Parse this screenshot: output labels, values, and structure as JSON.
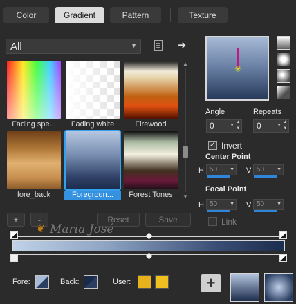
{
  "tabs": [
    {
      "label": "Color",
      "active": false
    },
    {
      "label": "Gradient",
      "active": true
    },
    {
      "label": "Pattern",
      "active": false
    },
    {
      "label": "Texture",
      "active": false
    }
  ],
  "category": {
    "selected": "All"
  },
  "gradients": [
    {
      "name": "Fading spe...",
      "selected": false
    },
    {
      "name": "Fading white",
      "selected": false
    },
    {
      "name": "Firewood",
      "selected": false
    },
    {
      "name": "fore_back",
      "selected": false
    },
    {
      "name": "Foregroun...",
      "selected": true
    },
    {
      "name": "Forest Tones",
      "selected": false
    }
  ],
  "list_buttons": {
    "add": "+",
    "remove": "-",
    "reset": "Reset",
    "save": "Save"
  },
  "watermark": "Maria José",
  "angle": {
    "label": "Angle",
    "value": "0"
  },
  "repeats": {
    "label": "Repeats",
    "value": "0"
  },
  "invert": {
    "label": "Invert",
    "checked": true
  },
  "center_point": {
    "label": "Center Point",
    "h_label": "H",
    "h": "50",
    "v_label": "V",
    "v": "50"
  },
  "focal_point": {
    "label": "Focal Point",
    "h_label": "H",
    "h": "50",
    "v_label": "V",
    "v": "50"
  },
  "link": {
    "label": "Link",
    "checked": false
  },
  "bottom": {
    "fore_label": "Fore:",
    "back_label": "Back:",
    "user_label": "User:"
  },
  "colors": {
    "accent": "#3592e0",
    "user_1": "#e8b21c",
    "user_2": "#f0c020",
    "marker": "#c01880",
    "center_dot": "#e0e61c"
  }
}
